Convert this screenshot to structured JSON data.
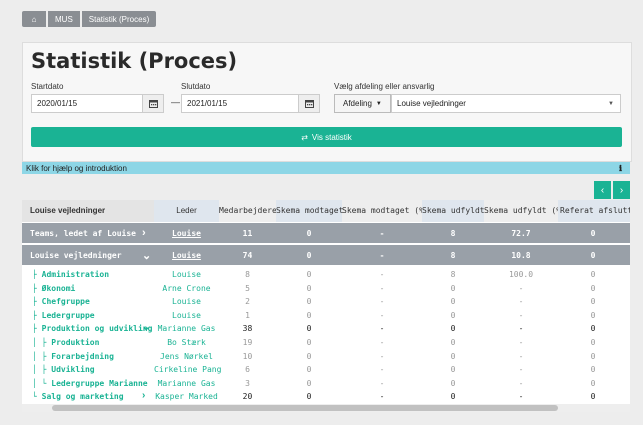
{
  "breadcrumb": {
    "home_icon": "⌂",
    "items": [
      "MUS",
      "Statistik (Proces)"
    ]
  },
  "page_title": "Statistik (Proces)",
  "form": {
    "start_label": "Startdato",
    "start_value": "2020/01/15",
    "end_label": "Slutdato",
    "end_value": "2021/01/15",
    "dept_label": "Vælg afdeling eller ansvarlig",
    "dept_type": "Afdeling",
    "dept_value": "Louise vejledninger",
    "show_button": "Vis statistik",
    "dash": "—"
  },
  "help_bar": "Klik for hjælp og introduktion",
  "table": {
    "headers": [
      "Louise vejledninger",
      "Leder",
      "Medarbejdere",
      "Skema modtaget",
      "Skema modtaget (%)",
      "Skema udfyldt",
      "Skema udfyldt (%)",
      "Referat afsluttet"
    ],
    "group_rows": [
      {
        "name": "Teams, ledet af Louise",
        "leder": "Louise",
        "cells": [
          "11",
          "0",
          "-",
          "8",
          "72.7",
          "0"
        ]
      },
      {
        "name": "Louise vejledninger",
        "leder": "Louise",
        "cells": [
          "74",
          "0",
          "-",
          "8",
          "10.8",
          "0"
        ]
      }
    ],
    "rows": [
      {
        "name": "├ Administration",
        "leder": "Louise",
        "cells": [
          "8",
          "0",
          "-",
          "8",
          "100.0",
          "0"
        ],
        "dark": false
      },
      {
        "name": "├ Økonomi",
        "leder": "Arne Crone",
        "cells": [
          "5",
          "0",
          "-",
          "0",
          "-",
          "0"
        ],
        "dark": false
      },
      {
        "name": "├ Chefgruppe",
        "leder": "Louise",
        "cells": [
          "2",
          "0",
          "-",
          "0",
          "-",
          "0"
        ],
        "dark": false
      },
      {
        "name": "├ Ledergruppe",
        "leder": "Louise",
        "cells": [
          "1",
          "0",
          "-",
          "0",
          "-",
          "0"
        ],
        "dark": false
      },
      {
        "name": "├ Produktion og udvikling",
        "leder": "Marianne Gas",
        "cells": [
          "38",
          "0",
          "-",
          "0",
          "-",
          "0"
        ],
        "dark": true
      },
      {
        "name": "│ ├ Produktion",
        "leder": "Bo Stærk",
        "cells": [
          "19",
          "0",
          "-",
          "0",
          "-",
          "0"
        ],
        "dark": false
      },
      {
        "name": "│ ├ Forarbejdning",
        "leder": "Jens Nørkel",
        "cells": [
          "10",
          "0",
          "-",
          "0",
          "-",
          "0"
        ],
        "dark": false
      },
      {
        "name": "│ ├ Udvikling",
        "leder": "Cirkeline Pang",
        "cells": [
          "6",
          "0",
          "-",
          "0",
          "-",
          "0"
        ],
        "dark": false
      },
      {
        "name": "│ └ Ledergruppe Marianne",
        "leder": "Marianne Gas",
        "cells": [
          "3",
          "0",
          "-",
          "0",
          "-",
          "0"
        ],
        "dark": false
      },
      {
        "name": "└ Salg og marketing",
        "leder": "Kasper Marked",
        "cells": [
          "20",
          "0",
          "-",
          "0",
          "-",
          "0"
        ],
        "dark": true
      }
    ]
  }
}
